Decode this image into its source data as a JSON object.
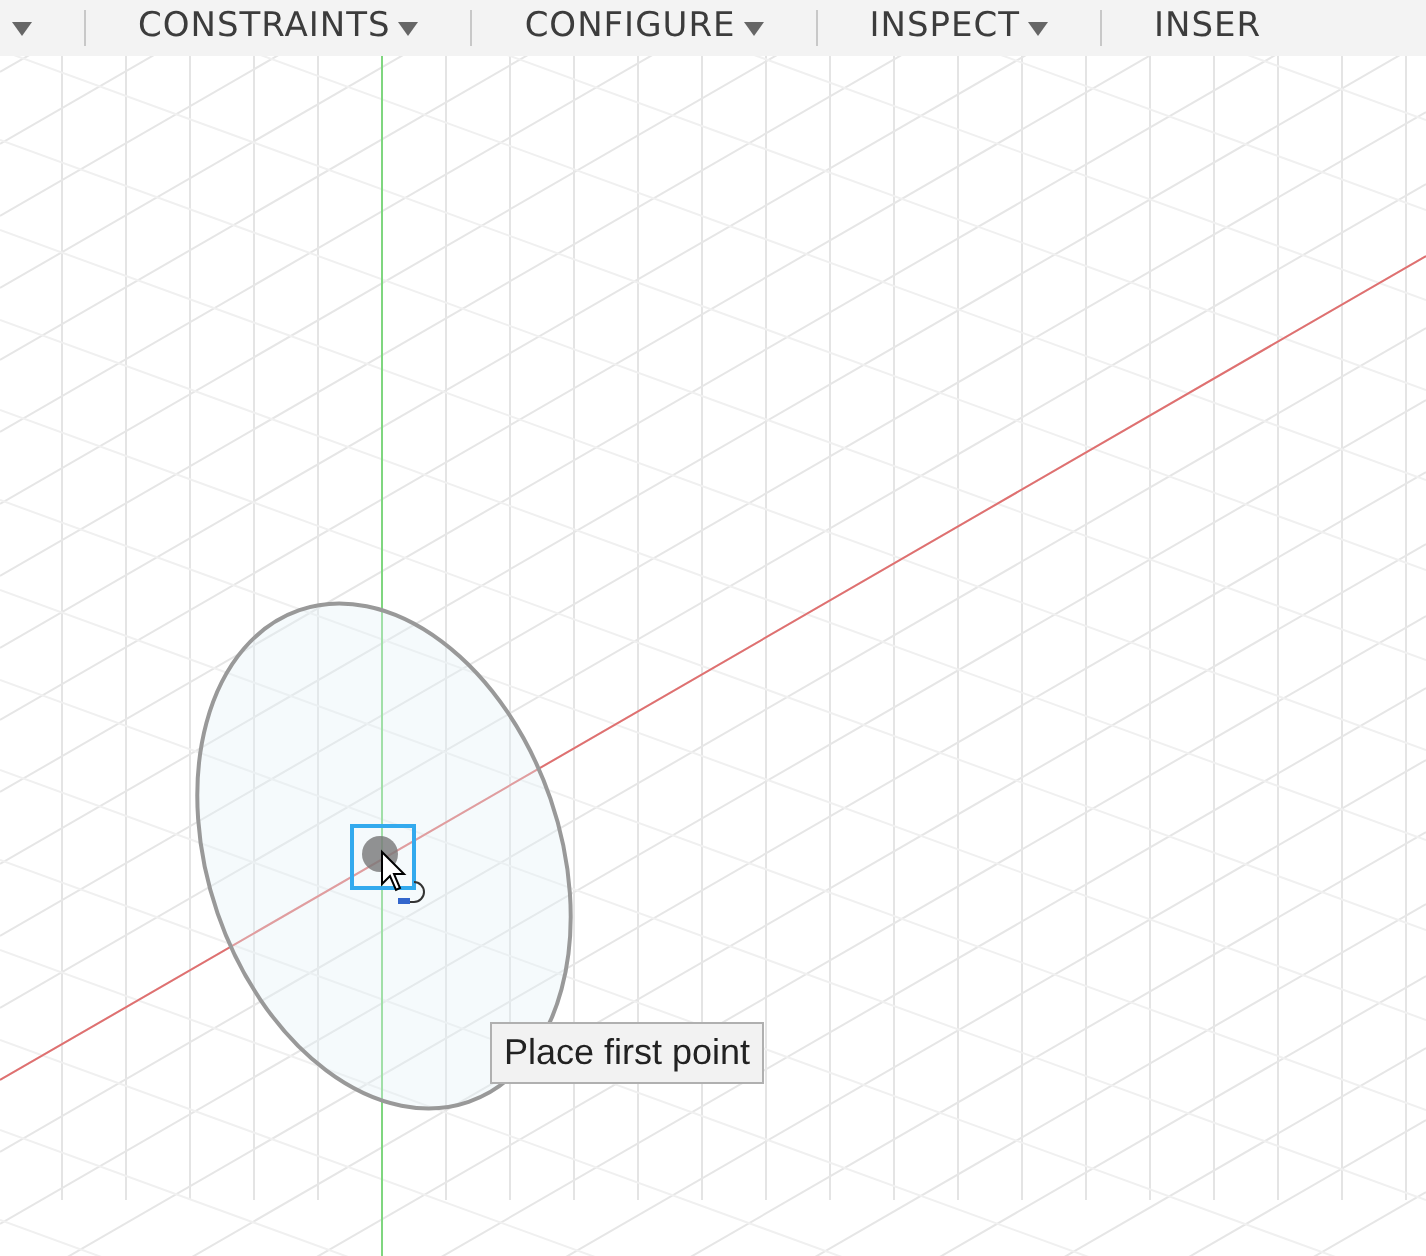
{
  "toolbar": {
    "menus": [
      {
        "label": "CONSTRAINTS",
        "caret": true
      },
      {
        "label": "CONFIGURE",
        "caret": true
      },
      {
        "label": "INSPECT",
        "caret": true
      },
      {
        "label": "INSER",
        "caret": false
      }
    ]
  },
  "canvas": {
    "tooltip": "Place first point"
  }
}
